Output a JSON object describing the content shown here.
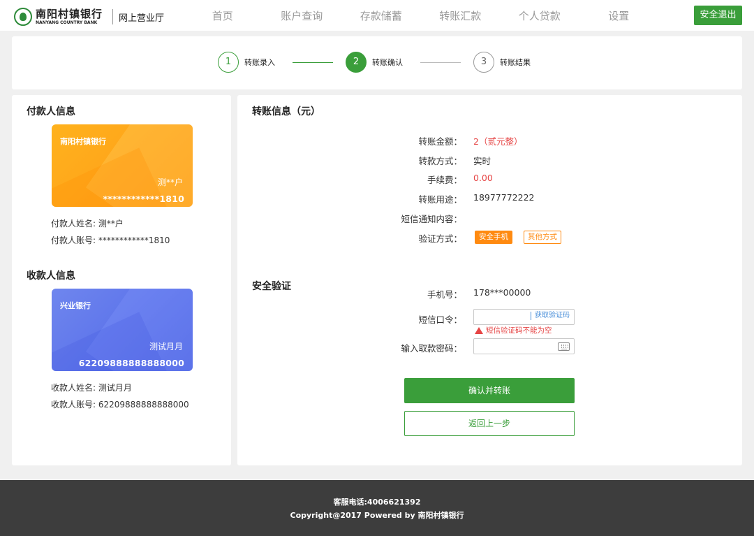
{
  "header": {
    "bank_name_cn": "南阳村镇银行",
    "bank_name_en": "NANYANG COUNTRY BANK",
    "sub_title": "网上营业厅",
    "nav": [
      "首页",
      "账户查询",
      "存款储蓄",
      "转账汇款",
      "个人贷款",
      "设置"
    ],
    "logout_label": "安全退出"
  },
  "steps": [
    {
      "num": "1",
      "label": "转账录入",
      "state": "done"
    },
    {
      "num": "2",
      "label": "转账确认",
      "state": "active"
    },
    {
      "num": "3",
      "label": "转账结果",
      "state": "pending"
    }
  ],
  "payer": {
    "title": "付款人信息",
    "card_bank": "南阳村镇银行",
    "card_name": "测**户",
    "card_no": "************1810",
    "name_line": "付款人姓名: 测**户",
    "account_line": "付款人账号: ************1810"
  },
  "payee": {
    "title": "收款人信息",
    "card_bank": "兴业银行",
    "card_name": "测试月月",
    "card_no": "62209888888888000",
    "name_line": "收款人姓名: 测试月月",
    "account_line": "收款人账号: 62209888888888000"
  },
  "transfer": {
    "title": "转账信息（元）",
    "amount_label": "转账金额：",
    "amount_value": "2（贰元整）",
    "mode_label": "转款方式：",
    "mode_value": "实时",
    "fee_label": "手续费：",
    "fee_value": "0.00",
    "purpose_label": "转账用途：",
    "purpose_value": "18977772222",
    "sms_label": "短信通知内容：",
    "sms_value": "",
    "verify_label": "验证方式：",
    "verify_primary": "安全手机",
    "verify_other": "其他方式"
  },
  "security": {
    "title": "安全验证",
    "phone_label": "手机号：",
    "phone_value": "178***00000",
    "code_label": "短信口令：",
    "code_value": "",
    "get_code_label": "获取验证码",
    "code_error": "短信验证码不能为空",
    "password_label": "输入取款密码：",
    "password_value": "",
    "confirm_label": "确认并转账",
    "back_label": "返回上一步"
  },
  "footer": {
    "hotline": "客服电话:4006621392",
    "copyright": "Copyright@2017 Powered by 南阳村镇银行"
  },
  "colors": {
    "accent_green": "#3a9e3a",
    "warning_red": "#e64545",
    "orange": "#ff8a10"
  }
}
